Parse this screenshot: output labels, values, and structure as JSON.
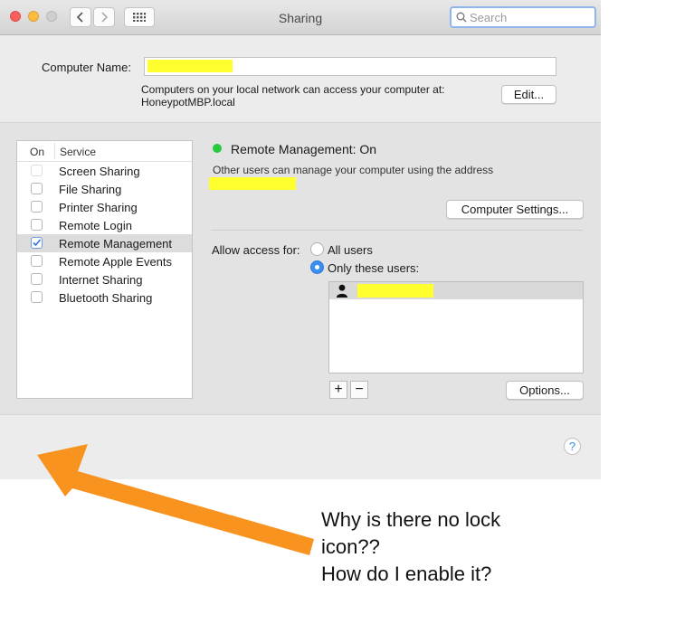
{
  "window": {
    "title": "Sharing",
    "search_placeholder": "Search"
  },
  "computer_name": {
    "label": "Computer Name:",
    "value": "",
    "info_line1": "Computers on your local network can access your computer at:",
    "info_line2": "HoneypotMBP.local",
    "edit_button": "Edit..."
  },
  "services": {
    "header_on": "On",
    "header_service": "Service",
    "items": [
      {
        "label": "Screen Sharing",
        "checked": false
      },
      {
        "label": "File Sharing",
        "checked": false
      },
      {
        "label": "Printer Sharing",
        "checked": false
      },
      {
        "label": "Remote Login",
        "checked": false
      },
      {
        "label": "Remote Management",
        "checked": true
      },
      {
        "label": "Remote Apple Events",
        "checked": false
      },
      {
        "label": "Internet Sharing",
        "checked": false
      },
      {
        "label": "Bluetooth Sharing",
        "checked": false
      }
    ]
  },
  "detail": {
    "status_text": "Remote Management: On",
    "status_color": "#28c940",
    "description": "Other users can manage your computer using the address",
    "computer_settings_button": "Computer Settings...",
    "allow_access_label": "Allow access for:",
    "radio_all_users": "All users",
    "radio_only_these": "Only these users:",
    "selected_access": "only_these_users",
    "add_symbol": "+",
    "remove_symbol": "−",
    "options_button": "Options..."
  },
  "help_symbol": "?",
  "annotation": {
    "line1": "Why is there no lock",
    "line2": "icon??",
    "line3": "How do I enable it?",
    "arrow_color": "#f7931e"
  },
  "colors": {
    "redaction": "#ffff2e",
    "accent": "#3b8ff0"
  }
}
